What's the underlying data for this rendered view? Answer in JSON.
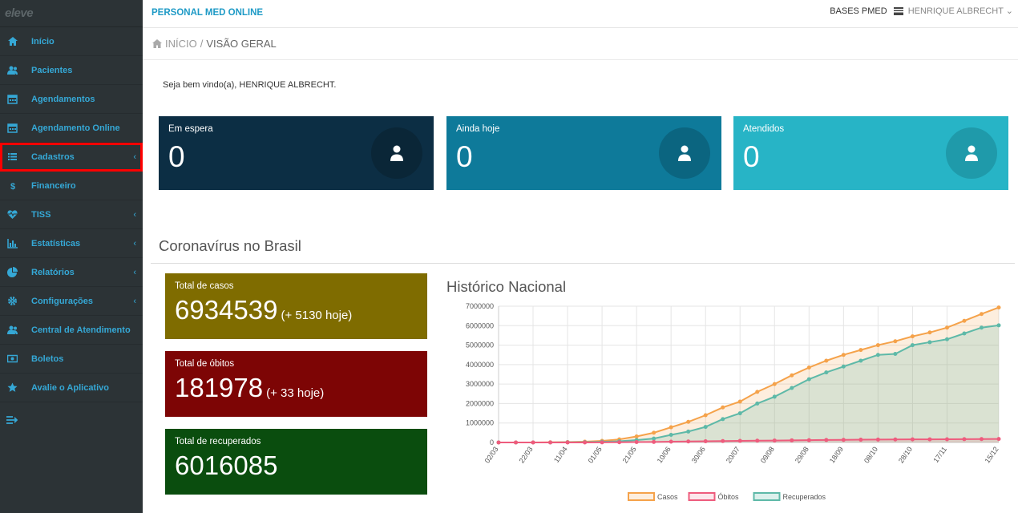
{
  "sidebar": {
    "logo": "eleve",
    "items": [
      {
        "label": "Início",
        "icon": "home-icon",
        "chevron": ""
      },
      {
        "label": "Pacientes",
        "icon": "users-icon",
        "chevron": ""
      },
      {
        "label": "Agendamentos",
        "icon": "calendar-icon",
        "chevron": ""
      },
      {
        "label": "Agendamento Online",
        "icon": "calendar-icon",
        "chevron": ""
      },
      {
        "label": "Cadastros",
        "icon": "list-icon",
        "chevron": "‹"
      },
      {
        "label": "Financeiro",
        "icon": "dollar-icon",
        "chevron": ""
      },
      {
        "label": "TISS",
        "icon": "heartbeat-icon",
        "chevron": "‹"
      },
      {
        "label": "Estatísticas",
        "icon": "bar-chart-icon",
        "chevron": "‹"
      },
      {
        "label": "Relatórios",
        "icon": "pie-chart-icon",
        "chevron": "‹"
      },
      {
        "label": "Configurações",
        "icon": "gear-icon",
        "chevron": "‹"
      },
      {
        "label": "Central de Atendimento",
        "icon": "users-icon",
        "chevron": ""
      },
      {
        "label": "Boletos",
        "icon": "money-icon",
        "chevron": ""
      },
      {
        "label": "Avalie o Aplicativo",
        "icon": "star-icon",
        "chevron": ""
      }
    ]
  },
  "topbar": {
    "brand": "PERSONAL MED ONLINE",
    "bases": "BASES PMED",
    "user": "HENRIQUE ALBRECHT",
    "user_chevron": "⌄"
  },
  "breadcrumb": {
    "home": "INÍCIO",
    "separator": "/",
    "current": "VISÃO GERAL"
  },
  "welcome": "Seja bem vindo(a), HENRIQUE ALBRECHT.",
  "stats": [
    {
      "label": "Em espera",
      "value": "0",
      "color": "#0c2e44",
      "circle": "#0a2637"
    },
    {
      "label": "Ainda hoje",
      "value": "0",
      "color": "#0e7a9a",
      "circle": "#0b6580"
    },
    {
      "label": "Atendidos",
      "value": "0",
      "color": "#27b4c6",
      "circle": "#1f9aaa"
    }
  ],
  "covid": {
    "section_title": "Coronavírus no Brasil",
    "boxes": [
      {
        "label": "Total de casos",
        "value": "6934539",
        "today": "(+ 5130 hoje)",
        "color": "#7f6c00"
      },
      {
        "label": "Total de óbitos",
        "value": "181978",
        "today": "(+ 33 hoje)",
        "color": "#7d0505"
      },
      {
        "label": "Total de recuperados",
        "value": "6016085",
        "today": "",
        "color": "#0a4d0e"
      }
    ]
  },
  "chart_data": {
    "type": "line",
    "title": "Histórico Nacional",
    "categories": [
      "02/03",
      "22/03",
      "11/04",
      "01/05",
      "21/05",
      "10/06",
      "30/06",
      "20/07",
      "09/08",
      "29/08",
      "18/09",
      "08/10",
      "28/10",
      "17/11",
      "15/12"
    ],
    "x_dates": [
      "02/03",
      "13/03",
      "22/03",
      "04/04",
      "11/04",
      "20/04",
      "01/05",
      "10/05",
      "21/05",
      "30/05",
      "10/06",
      "20/06",
      "30/06",
      "10/07",
      "20/07",
      "30/07",
      "09/08",
      "19/08",
      "29/08",
      "08/09",
      "18/09",
      "28/09",
      "08/10",
      "18/10",
      "28/10",
      "07/11",
      "17/11",
      "27/11",
      "07/12",
      "15/12"
    ],
    "series": [
      {
        "name": "Casos",
        "color": "#f5a24a",
        "values": [
          2,
          120,
          1500,
          10000,
          20000,
          40000,
          80000,
          160000,
          310000,
          500000,
          780000,
          1060000,
          1400000,
          1800000,
          2100000,
          2600000,
          3000000,
          3450000,
          3850000,
          4200000,
          4500000,
          4750000,
          5000000,
          5200000,
          5450000,
          5650000,
          5900000,
          6250000,
          6600000,
          6934539
        ]
      },
      {
        "name": "Óbitos",
        "color": "#ee5c7d",
        "values": [
          0,
          0,
          80,
          500,
          1200,
          2500,
          5500,
          10000,
          20000,
          28000,
          40000,
          50000,
          60000,
          72000,
          82000,
          92000,
          100000,
          110000,
          120000,
          127000,
          135000,
          142000,
          148000,
          154000,
          158000,
          162000,
          166000,
          170000,
          176000,
          181978
        ]
      },
      {
        "name": "Recuperados",
        "color": "#5eb9a8",
        "values": [
          0,
          0,
          0,
          0,
          8000,
          15000,
          35000,
          60000,
          125000,
          200000,
          390000,
          560000,
          800000,
          1200000,
          1500000,
          2000000,
          2350000,
          2800000,
          3250000,
          3600000,
          3900000,
          4200000,
          4500000,
          4550000,
          5000000,
          5150000,
          5300000,
          5600000,
          5900000,
          6016085
        ]
      }
    ],
    "ylim": [
      0,
      7000000
    ],
    "yticks": [
      "0",
      "1000000",
      "2000000",
      "3000000",
      "4000000",
      "5000000",
      "6000000",
      "7000000"
    ],
    "grid": true,
    "legend": "bottom"
  }
}
